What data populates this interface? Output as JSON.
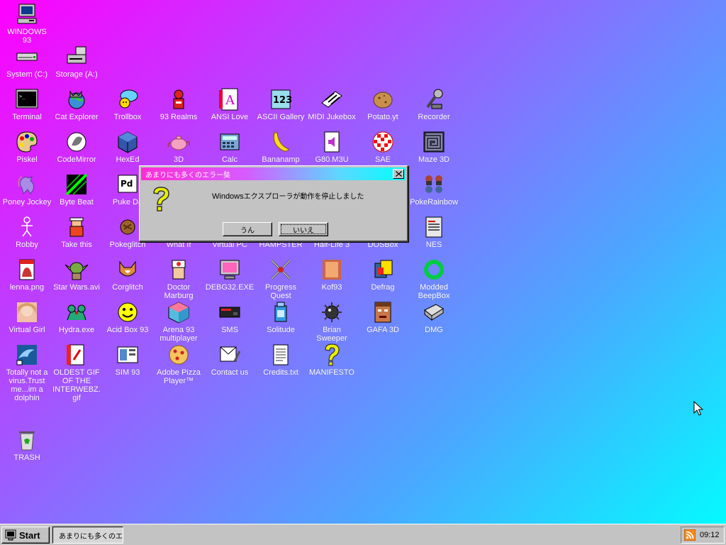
{
  "colors": {
    "titlebar_start": "#ff2bd5",
    "titlebar_end": "#00ffff",
    "face": "#c3c3c3"
  },
  "desktop": {
    "icons": [
      {
        "label": "WINDOWS 93",
        "icon": "computer-icon"
      },
      {
        "label": "System (C:)",
        "icon": "drive-icon"
      },
      {
        "label": "Storage (A:)",
        "icon": "floppy-drive-icon"
      },
      {
        "label": "Terminal",
        "icon": "terminal-icon"
      },
      {
        "label": "Cat Explorer",
        "icon": "cat-globe-icon"
      },
      {
        "label": "Trollbox",
        "icon": "chat-icon"
      },
      {
        "label": "93 Realms",
        "icon": "realms-icon"
      },
      {
        "label": "ANSI Love",
        "icon": "ansi-icon"
      },
      {
        "label": "ASCII Gallery",
        "icon": "ascii-icon"
      },
      {
        "label": "MIDI Jukebox",
        "icon": "piano-icon"
      },
      {
        "label": "Potato.yt",
        "icon": "potato-icon"
      },
      {
        "label": "Recorder",
        "icon": "microphone-icon"
      },
      {
        "label": "Piskel",
        "icon": "palette-icon"
      },
      {
        "label": "CodeMirror",
        "icon": "codemirror-icon"
      },
      {
        "label": "HexEd",
        "icon": "cube-icon"
      },
      {
        "label": "3D",
        "icon": "teapot-icon"
      },
      {
        "label": "Calc",
        "icon": "calculator-icon"
      },
      {
        "label": "Bananamp",
        "icon": "banana-icon"
      },
      {
        "label": "G80.M3U",
        "icon": "audio-file-icon"
      },
      {
        "label": "SAE",
        "icon": "ball-icon"
      },
      {
        "label": "Maze 3D",
        "icon": "maze-icon"
      },
      {
        "label": "Poney Jockey",
        "icon": "pony-icon"
      },
      {
        "label": "Byte Beat",
        "icon": "bytebeat-icon"
      },
      {
        "label": "Puke Da",
        "icon": "puredata-icon"
      },
      {
        "label": "PokeRainbow",
        "icon": "pokerainbow-icon"
      },
      {
        "label": "Robby",
        "icon": "stickman-icon"
      },
      {
        "label": "Take this",
        "icon": "take-this-icon"
      },
      {
        "label": "Pokeglitch",
        "icon": "pokeglitch-icon"
      },
      {
        "label": "What If",
        "icon": "what-if-icon"
      },
      {
        "label": "Virtual PC",
        "icon": "virtual-pc-icon"
      },
      {
        "label": "HAMPSTER",
        "icon": "hampster-icon"
      },
      {
        "label": "Half-Life 3",
        "icon": "half-life-icon"
      },
      {
        "label": "DOSBox",
        "icon": "dosbox-icon"
      },
      {
        "label": "NES",
        "icon": "nes-icon"
      },
      {
        "label": "lenna.png",
        "icon": "image-file-icon"
      },
      {
        "label": "Star Wars.avi",
        "icon": "yoda-icon"
      },
      {
        "label": "Corglitch",
        "icon": "corgi-icon"
      },
      {
        "label": "Doctor Marburg",
        "icon": "doctor-icon"
      },
      {
        "label": "DEBG32.EXE",
        "icon": "debug-monitor-icon"
      },
      {
        "label": "Progress Quest",
        "icon": "swords-icon"
      },
      {
        "label": "Kof93",
        "icon": "fighter-icon"
      },
      {
        "label": "Defrag",
        "icon": "defrag-icon"
      },
      {
        "label": "Modded BeepBox",
        "icon": "ring-icon"
      },
      {
        "label": "Virtual Girl",
        "icon": "virtual-girl-icon"
      },
      {
        "label": "Hydra.exe",
        "icon": "hydra-icon"
      },
      {
        "label": "Acid Box 93",
        "icon": "smiley-icon"
      },
      {
        "label": "Arena 93 multiplayer",
        "icon": "arena-cube-icon"
      },
      {
        "label": "SMS",
        "icon": "sms-console-icon"
      },
      {
        "label": "Solitude",
        "icon": "solitude-icon"
      },
      {
        "label": "Brian Sweeper",
        "icon": "mine-icon"
      },
      {
        "label": "GAFA 3D",
        "icon": "doom-face-icon"
      },
      {
        "label": "DMG",
        "icon": "gameboy-icon"
      },
      {
        "label": "Totally not a virus.Trust me...im a dolphin",
        "icon": "dolphin-icon"
      },
      {
        "label": "OLDEST GIF OF THE INTERWEBZ.gif",
        "icon": "gif-file-icon"
      },
      {
        "label": "SIM 93",
        "icon": "sim-icon"
      },
      {
        "label": "Adobe Pizza Player™",
        "icon": "pizza-icon"
      },
      {
        "label": "Contact us",
        "icon": "contact-icon"
      },
      {
        "label": "Credits.txt",
        "icon": "text-file-icon"
      },
      {
        "label": "MANIFESTO",
        "icon": "question-icon"
      },
      {
        "label": "TRASH",
        "icon": "trash-icon"
      }
    ]
  },
  "dialog": {
    "title": "あまりにも多くのエラー奘",
    "message_prefix": "Windows",
    "message_suffix": "エクスプローラが動作を停止しました",
    "icon": "question-icon",
    "btn_yes": "うん",
    "btn_no": "いいえ"
  },
  "taskbar": {
    "start_label": "Start",
    "task_label": "あまりにも多くのエ...",
    "tray_icon": "rss-icon",
    "clock": "09:12"
  }
}
